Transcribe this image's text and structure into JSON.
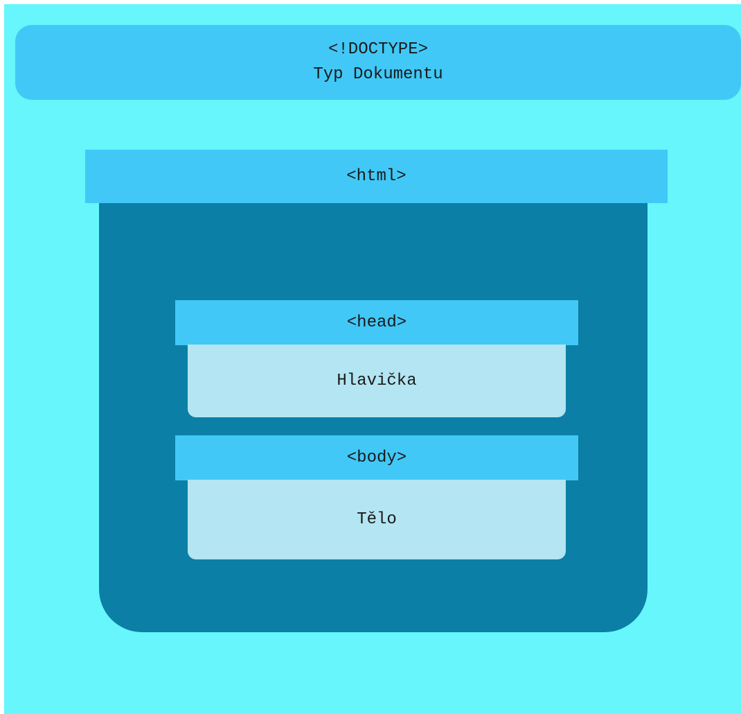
{
  "doctype": {
    "tag": "<!DOCTYPE>",
    "label": "Typ Dokumentu"
  },
  "html": {
    "tag": "<html>"
  },
  "head": {
    "tag": "<head>",
    "label": "Hlavička"
  },
  "body": {
    "tag": "<body>",
    "label": "Tělo"
  },
  "colors": {
    "background": "#66f6fb",
    "tag_bar": "#41c8f6",
    "html_container": "#0b7fa5",
    "content_panel": "#b3e5f2"
  }
}
